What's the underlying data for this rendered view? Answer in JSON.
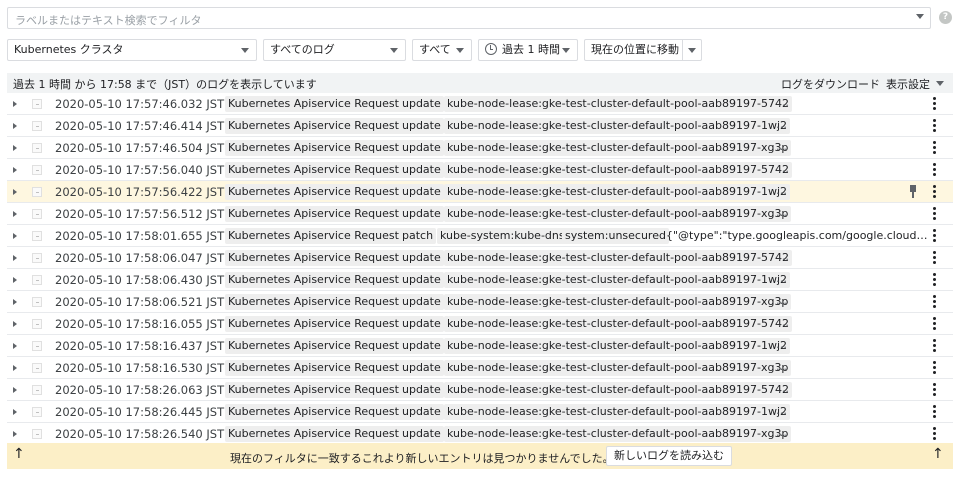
{
  "filter": {
    "placeholder": "ラベルまたはテキスト検索でフィルタ"
  },
  "controls": {
    "resource": "Kubernetes クラスタ",
    "logs": "すべてのログ",
    "severity": "すべて",
    "time_range": "過去 1 時間",
    "jump": "現在の位置に移動"
  },
  "status": {
    "text": "過去 1 時間 から 17:58 まで（JST）のログを表示しています",
    "download": "ログをダウンロード",
    "display_settings": "表示設定"
  },
  "rows": [
    {
      "ts": "2020-05-10 17:57:46.032 JST",
      "service": "Kubernetes Apiservice Requests",
      "method": "update",
      "resource": "kube-node-lease:gke-test-cluster-default-pool-aab89197-5742",
      "more": "…"
    },
    {
      "ts": "2020-05-10 17:57:46.414 JST",
      "service": "Kubernetes Apiservice Requests",
      "method": "update",
      "resource": "kube-node-lease:gke-test-cluster-default-pool-aab89197-1wj2",
      "more": "…"
    },
    {
      "ts": "2020-05-10 17:57:46.504 JST",
      "service": "Kubernetes Apiservice Requests",
      "method": "update",
      "resource": "kube-node-lease:gke-test-cluster-default-pool-aab89197-xg3p",
      "more": "…"
    },
    {
      "ts": "2020-05-10 17:57:56.040 JST",
      "service": "Kubernetes Apiservice Requests",
      "method": "update",
      "resource": "kube-node-lease:gke-test-cluster-default-pool-aab89197-5742",
      "more": "…"
    },
    {
      "ts": "2020-05-10 17:57:56.422 JST",
      "service": "Kubernetes Apiservice Requests",
      "method": "update",
      "resource": "kube-node-lease:gke-test-cluster-default-pool-aab89197-1wj2",
      "more": "…",
      "highlighted": true
    },
    {
      "ts": "2020-05-10 17:57:56.512 JST",
      "service": "Kubernetes Apiservice Requests",
      "method": "update",
      "resource": "kube-node-lease:gke-test-cluster-default-pool-aab89197-xg3p",
      "more": "…"
    },
    {
      "ts": "2020-05-10 17:58:01.655 JST",
      "service": "Kubernetes Apiservice Requests",
      "method": "patch",
      "resource": "kube-system:kube-dns",
      "principal": "system:unsecured",
      "payload": "{\"@type\":\"type.googleapis.com/google.cloud.…"
    },
    {
      "ts": "2020-05-10 17:58:06.047 JST",
      "service": "Kubernetes Apiservice Requests",
      "method": "update",
      "resource": "kube-node-lease:gke-test-cluster-default-pool-aab89197-5742",
      "more": "…"
    },
    {
      "ts": "2020-05-10 17:58:06.430 JST",
      "service": "Kubernetes Apiservice Requests",
      "method": "update",
      "resource": "kube-node-lease:gke-test-cluster-default-pool-aab89197-1wj2",
      "more": "…"
    },
    {
      "ts": "2020-05-10 17:58:06.521 JST",
      "service": "Kubernetes Apiservice Requests",
      "method": "update",
      "resource": "kube-node-lease:gke-test-cluster-default-pool-aab89197-xg3p",
      "more": "…"
    },
    {
      "ts": "2020-05-10 17:58:16.055 JST",
      "service": "Kubernetes Apiservice Requests",
      "method": "update",
      "resource": "kube-node-lease:gke-test-cluster-default-pool-aab89197-5742",
      "more": "…"
    },
    {
      "ts": "2020-05-10 17:58:16.437 JST",
      "service": "Kubernetes Apiservice Requests",
      "method": "update",
      "resource": "kube-node-lease:gke-test-cluster-default-pool-aab89197-1wj2",
      "more": "…"
    },
    {
      "ts": "2020-05-10 17:58:16.530 JST",
      "service": "Kubernetes Apiservice Requests",
      "method": "update",
      "resource": "kube-node-lease:gke-test-cluster-default-pool-aab89197-xg3p",
      "more": "…"
    },
    {
      "ts": "2020-05-10 17:58:26.063 JST",
      "service": "Kubernetes Apiservice Requests",
      "method": "update",
      "resource": "kube-node-lease:gke-test-cluster-default-pool-aab89197-5742",
      "more": "…"
    },
    {
      "ts": "2020-05-10 17:58:26.445 JST",
      "service": "Kubernetes Apiservice Requests",
      "method": "update",
      "resource": "kube-node-lease:gke-test-cluster-default-pool-aab89197-1wj2",
      "more": "…"
    },
    {
      "ts": "2020-05-10 17:58:26.540 JST",
      "service": "Kubernetes Apiservice Requests",
      "method": "update",
      "resource": "kube-node-lease:gke-test-cluster-default-pool-aab89197-xg3p",
      "more": "…"
    }
  ],
  "footer": {
    "message": "現在のフィルタに一致するこれより新しいエントリは見つかりませんでした。",
    "load_newer": "新しいログを読み込む",
    "arrow": "↑"
  },
  "icons": {
    "help": "help-icon",
    "pin": "pin-icon",
    "row_menu": "more-vert-icon",
    "time": "clock-icon"
  },
  "colors": {
    "highlight_row": "#fef7e0",
    "footer_bg": "#fcefc7",
    "status_bg": "#f1f3f4"
  }
}
